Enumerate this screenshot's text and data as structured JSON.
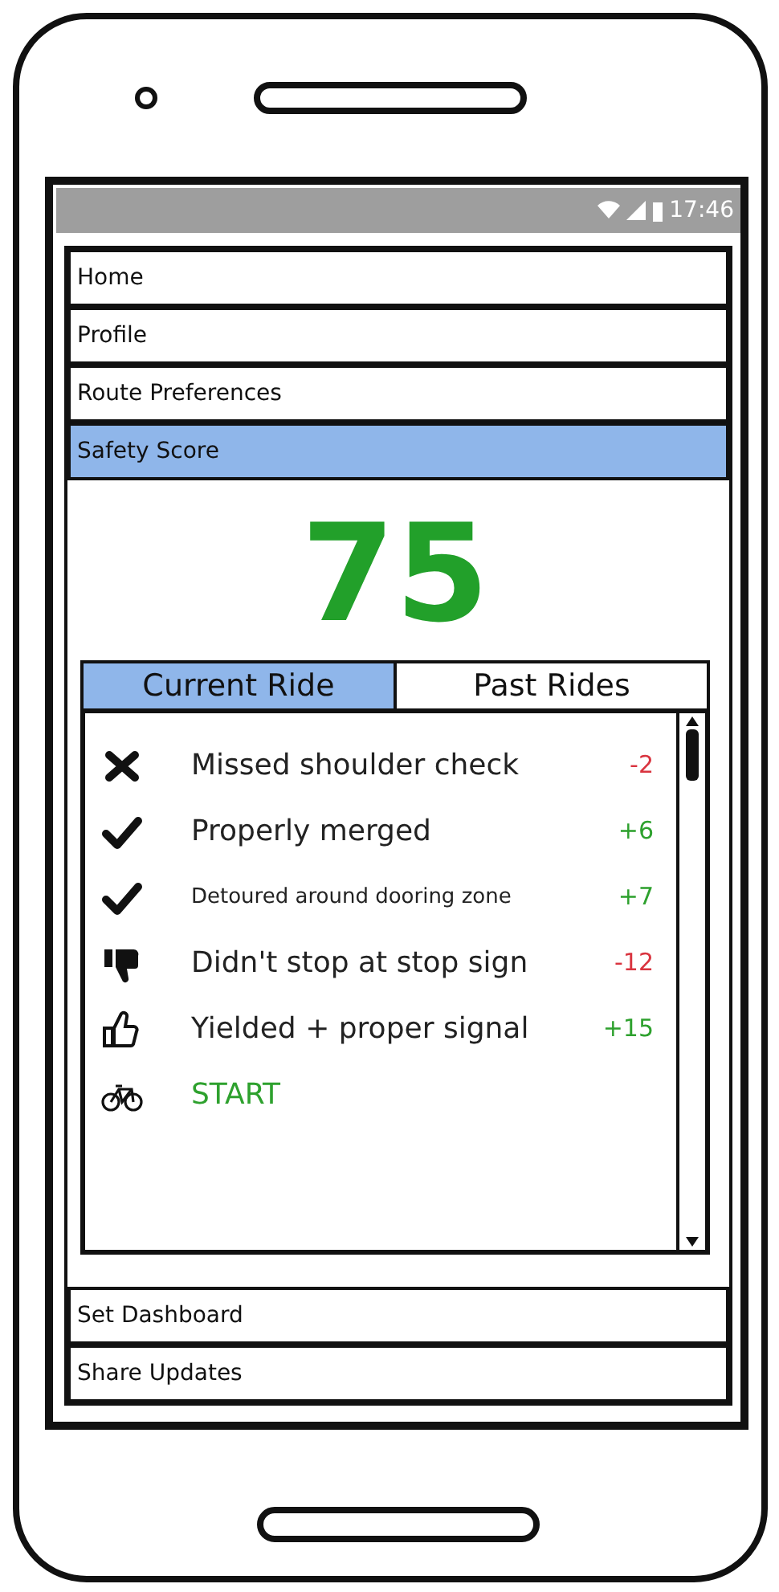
{
  "status_bar": {
    "time": "17:46"
  },
  "menu_top": [
    {
      "label": "Home",
      "selected": false
    },
    {
      "label": "Profile",
      "selected": false
    },
    {
      "label": "Route Preferences",
      "selected": false
    },
    {
      "label": "Safety Score",
      "selected": true
    }
  ],
  "score": "75",
  "tabs": [
    {
      "label": "Current Ride",
      "selected": true
    },
    {
      "label": "Past Rides",
      "selected": false
    }
  ],
  "events": [
    {
      "kind": "cross",
      "label": "Missed shoulder check",
      "points": "-2",
      "color": "#d9343f"
    },
    {
      "kind": "check",
      "label": "Properly merged",
      "points": "+6",
      "color": "#2ea12e"
    },
    {
      "kind": "check",
      "label": "Detoured around dooring zone",
      "points": "+7",
      "color": "#2ea12e",
      "small": true
    },
    {
      "kind": "thumbs-down",
      "label": "Didn't stop at stop sign",
      "points": "-12",
      "color": "#d9343f"
    },
    {
      "kind": "thumbs-up",
      "label": "Yielded + proper signal",
      "points": "+15",
      "color": "#2ea12e"
    },
    {
      "kind": "bike",
      "label": "START",
      "color": "#2ea12e"
    }
  ],
  "menu_bottom": [
    {
      "label": "Set Dashboard",
      "selected": false
    },
    {
      "label": "Share Updates",
      "selected": false
    }
  ]
}
